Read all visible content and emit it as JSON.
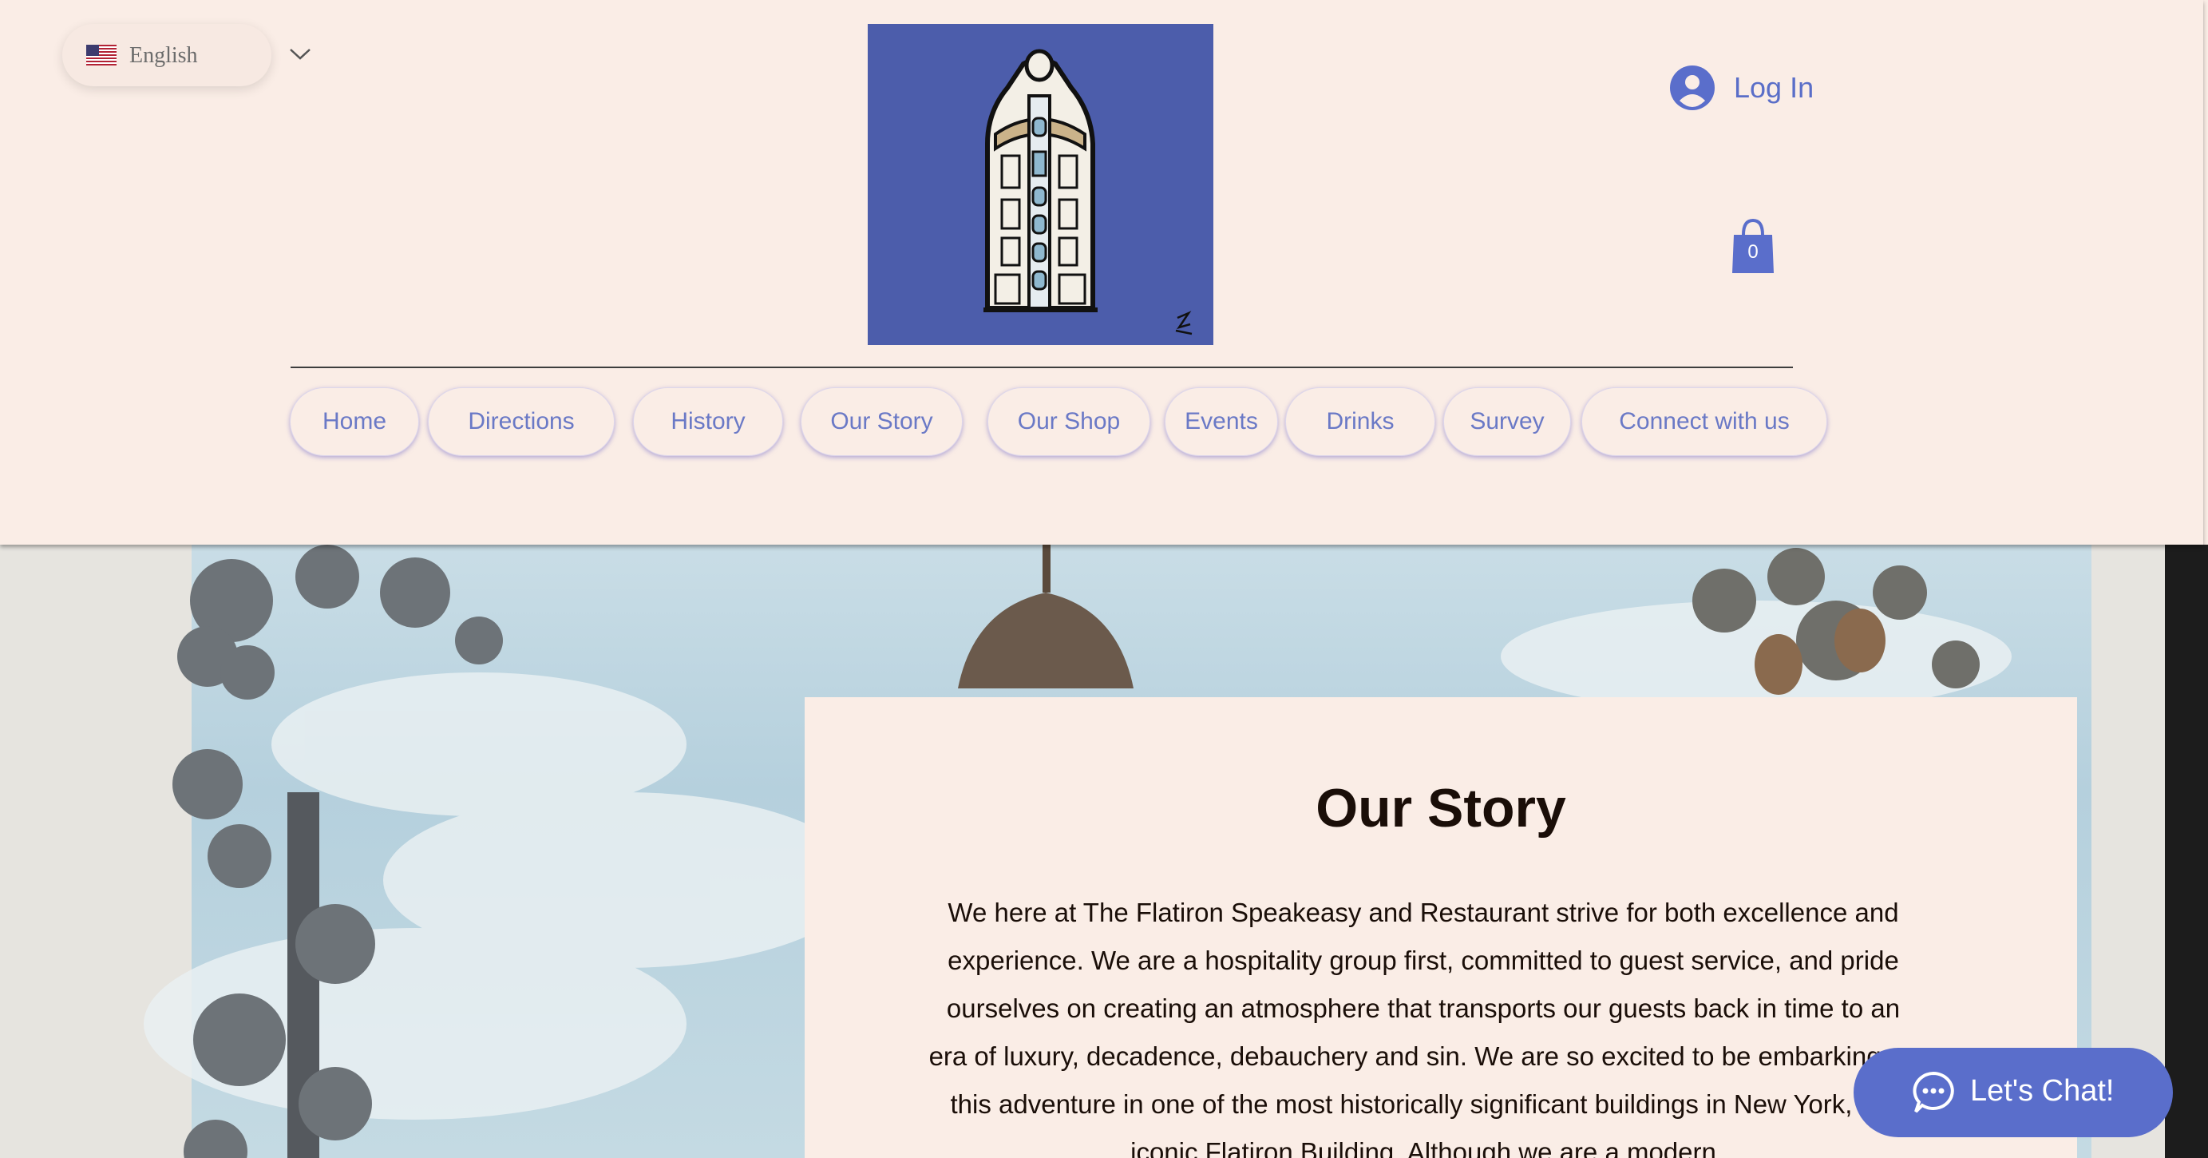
{
  "language": {
    "label": "English",
    "flag_icon": "us-flag-icon"
  },
  "header": {
    "login_label": "Log In",
    "cart_count": "0"
  },
  "nav": {
    "items": [
      {
        "label": "Home"
      },
      {
        "label": "Directions"
      },
      {
        "label": "History"
      },
      {
        "label": "Our Story"
      },
      {
        "label": "Our Shop"
      },
      {
        "label": "Events"
      },
      {
        "label": "Drinks"
      },
      {
        "label": "Survey"
      },
      {
        "label": "Connect with us"
      }
    ]
  },
  "story": {
    "title": "Our Story",
    "body": "We here at The Flatiron Speakeasy and Restaurant strive for both excellence and experience. We are a hospitality group first, committed to guest service, and pride ourselves on creating an atmosphere that transports our guests back in time to an era of luxury, decadence, debauchery and sin. We are so excited to be embarking on this adventure in one of the most historically significant buildings in New York, the iconic Flatiron Building. Although we are a modern"
  },
  "chat": {
    "label": "Let's Chat!"
  },
  "colors": {
    "background": "#faede6",
    "accent": "#5a6ecb",
    "logo_bg": "#4c5dab",
    "nav_text": "#6a79c6"
  }
}
